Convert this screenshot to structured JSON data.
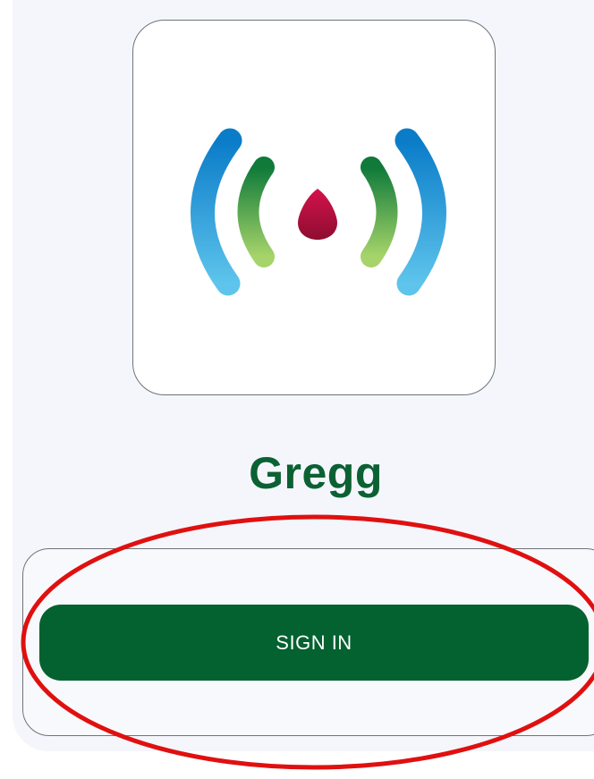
{
  "app": {
    "name": "Gregg",
    "logo_icon": "signal-broadcast-icon"
  },
  "auth": {
    "sign_in_label": "SIGN IN"
  },
  "colors": {
    "brand_green": "#03622f",
    "title_green": "#0b6133",
    "background": "#f4f6fb",
    "logo_blue": "#1a86cf",
    "logo_green": "#3a9a3e",
    "logo_red": "#b0123a",
    "annotation_red": "#e01010"
  }
}
